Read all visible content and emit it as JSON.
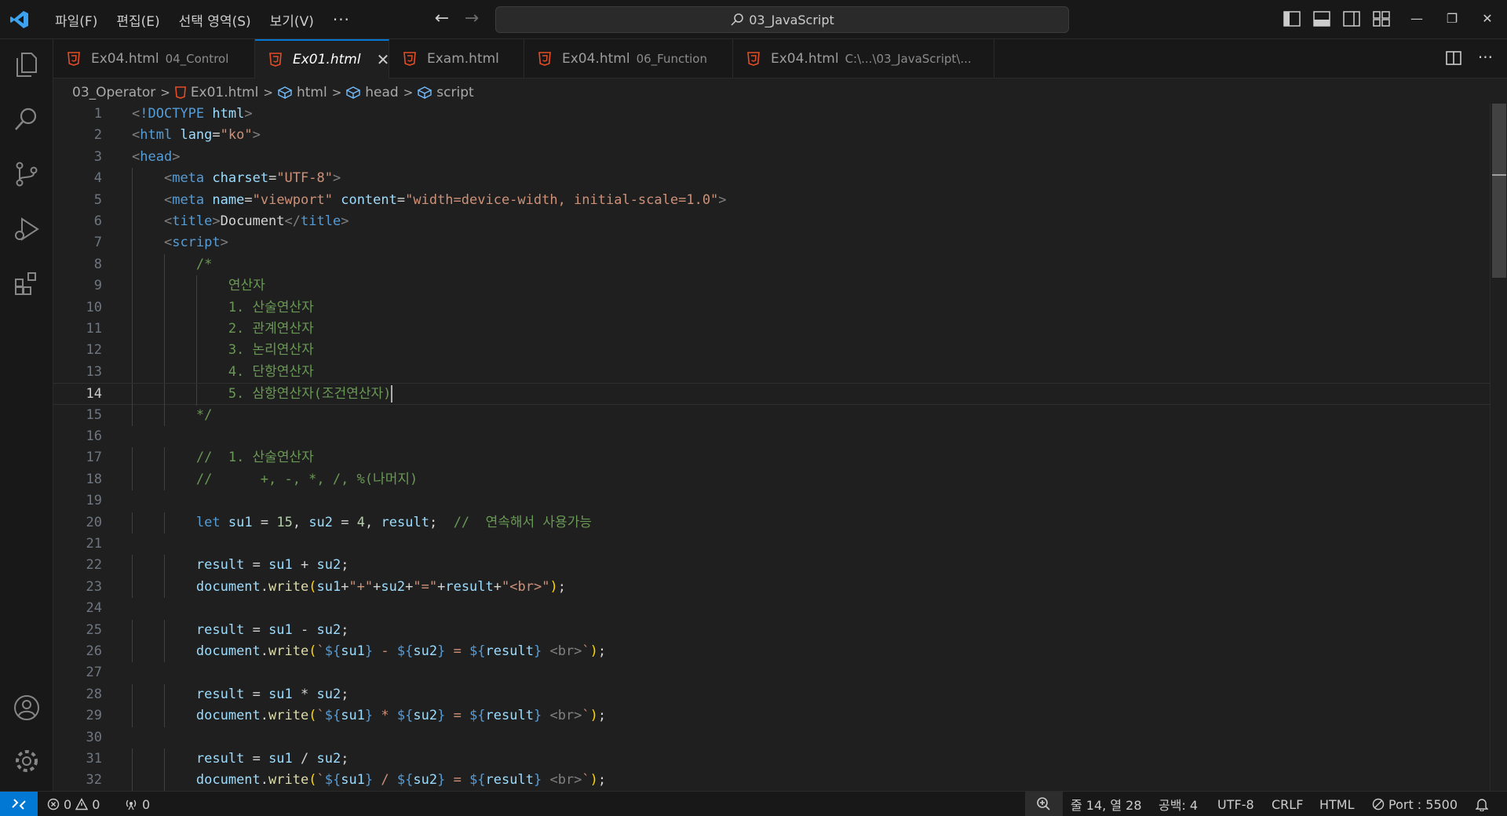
{
  "titlebar": {
    "menu": [
      "파일(F)",
      "편집(E)",
      "선택 영역(S)",
      "보기(V)"
    ],
    "more": "···",
    "search_text": "03_JavaScript"
  },
  "tabs": [
    {
      "name": "Ex04.html",
      "desc": "04_Control",
      "active": false
    },
    {
      "name": "Ex01.html",
      "desc": "",
      "active": true
    },
    {
      "name": "Exam.html",
      "desc": "",
      "active": false
    },
    {
      "name": "Ex04.html",
      "desc": "06_Function",
      "active": false
    },
    {
      "name": "Ex04.html",
      "desc": "C:\\...\\03_JavaScript\\...",
      "active": false
    }
  ],
  "breadcrumb": {
    "folder": "03_Operator",
    "file": "Ex01.html",
    "html": "html",
    "head": "head",
    "script": "script"
  },
  "editor": {
    "current_line": 14,
    "lines": [
      "<!DOCTYPE html>",
      "<html lang=\"ko\">",
      "<head>",
      "    <meta charset=\"UTF-8\">",
      "    <meta name=\"viewport\" content=\"width=device-width, initial-scale=1.0\">",
      "    <title>Document</title>",
      "    <script>",
      "        /*",
      "            연산자",
      "            1. 산술연산자",
      "            2. 관계연산자",
      "            3. 논리연산자",
      "            4. 단항연산자",
      "            5. 삼항연산자(조건연산자)",
      "        */",
      "",
      "        //  1. 산술연산자",
      "        //      +, -, *, /, %(나머지)",
      "",
      "        let su1 = 15, su2 = 4, result;  //  연속해서 사용가능",
      "",
      "        result = su1 + su2;",
      "        document.write(su1+\"+\"+su2+\"=\"+result+\"<br>\");",
      "",
      "        result = su1 - su2;",
      "        document.write(`${su1} - ${su2} = ${result} <br>`);",
      "",
      "        result = su1 * su2;",
      "        document.write(`${su1} * ${su2} = ${result} <br>`);",
      "",
      "        result = su1 / su2;",
      "        document.write(`${su1} / ${su2} = ${result} <br>`);"
    ]
  },
  "statusbar": {
    "errors": "0",
    "warnings": "0",
    "ports": "0",
    "position": "줄 14, 열 28",
    "spaces": "공백: 4",
    "encoding": "UTF-8",
    "eol": "CRLF",
    "language": "HTML",
    "port": "Port : 5500"
  },
  "colors": {
    "accent": "#0078d4",
    "html_icon": "#e44d26"
  }
}
